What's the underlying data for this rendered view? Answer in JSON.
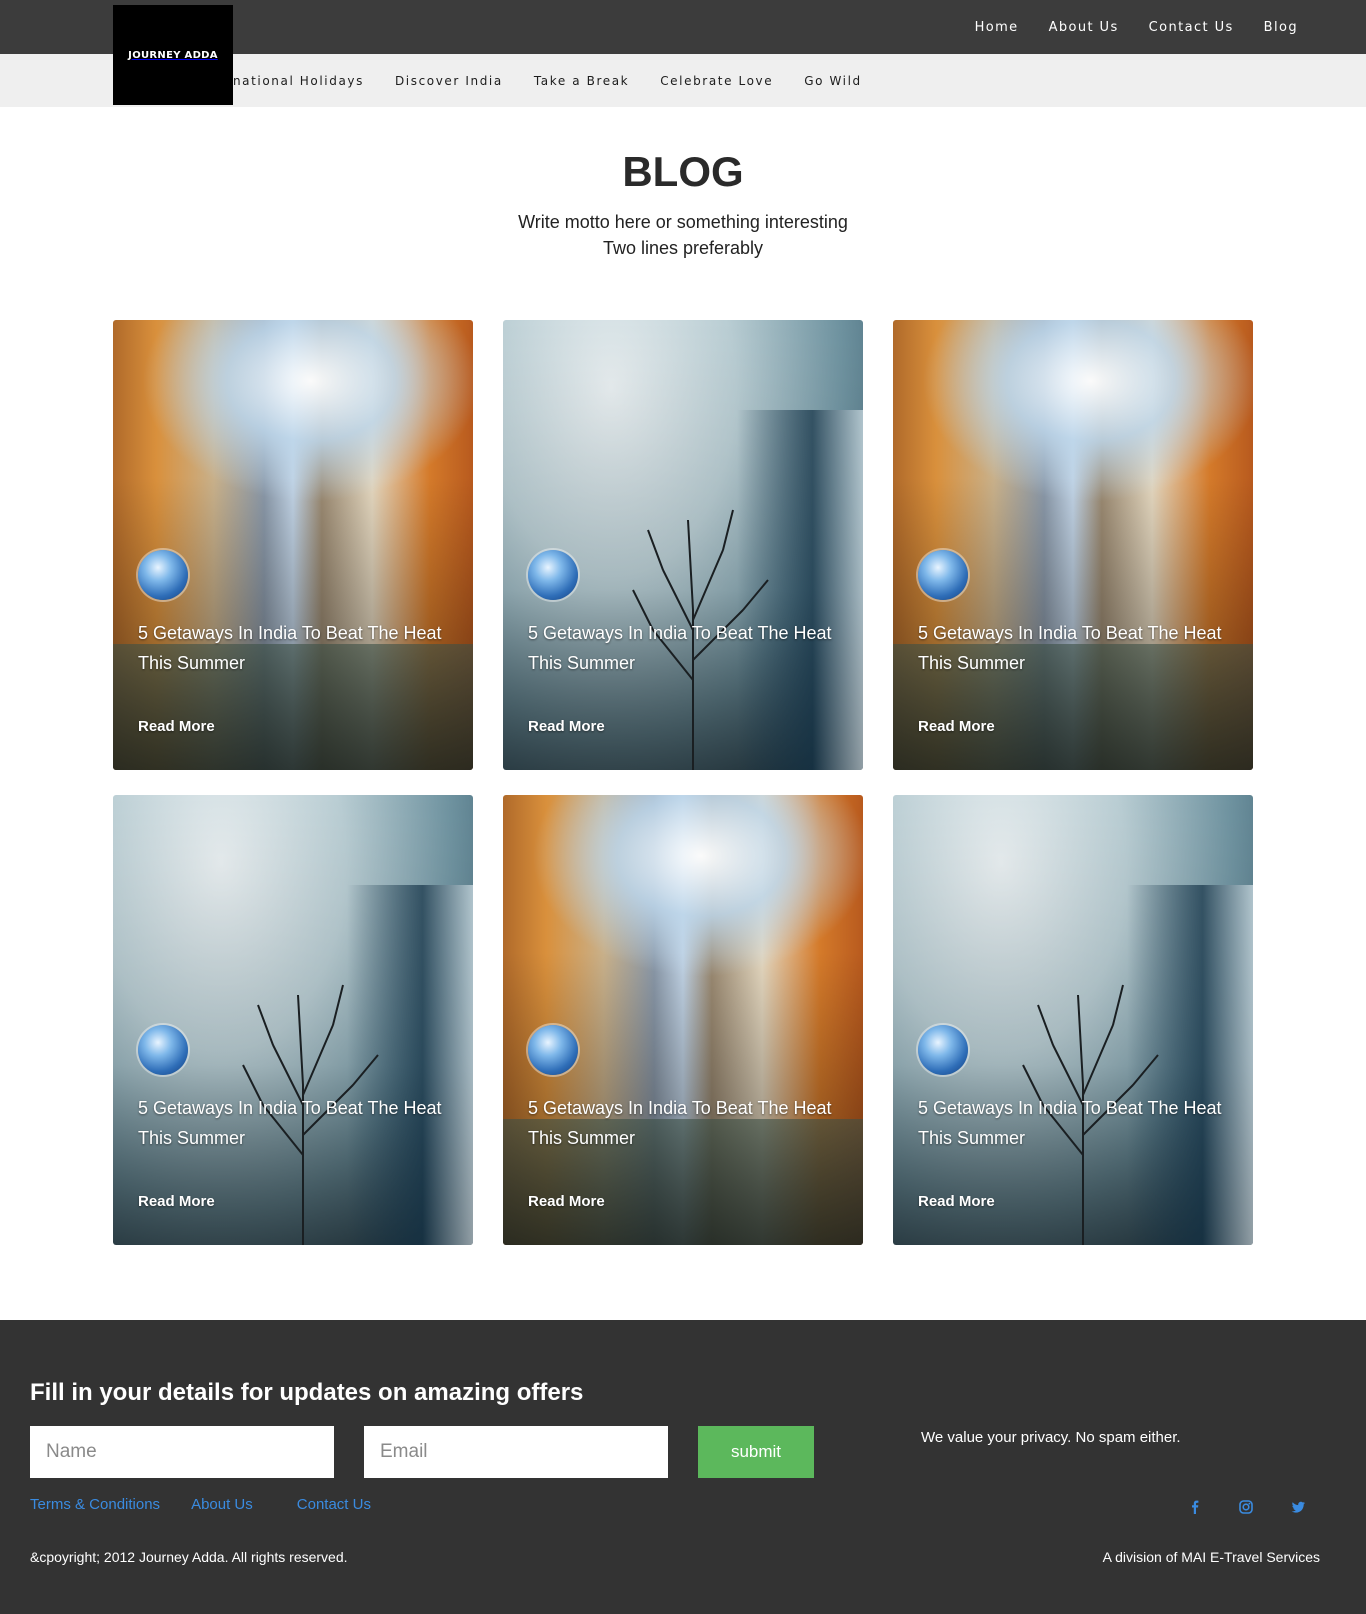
{
  "header": {
    "logo_text": "JOURNEY ADDA",
    "nav": [
      "Home",
      "About Us",
      "Contact Us",
      "Blog"
    ],
    "subnav": [
      "International Holidays",
      "Discover India",
      "Take a Break",
      "Celebrate Love",
      "Go Wild"
    ]
  },
  "hero": {
    "title": "BLOG",
    "motto_line1": "Write motto here or something interesting",
    "motto_line2": "Two lines preferably"
  },
  "posts": [
    {
      "image": "canal",
      "title": "5 Getaways In India To Beat The Heat This Summer",
      "cta": "Read More"
    },
    {
      "image": "fog",
      "title": "5 Getaways In India To Beat The Heat This Summer",
      "cta": "Read More"
    },
    {
      "image": "canal",
      "title": "5 Getaways In India To Beat The Heat This Summer",
      "cta": "Read More"
    },
    {
      "image": "fog",
      "title": "5 Getaways In India To Beat The Heat This Summer",
      "cta": "Read More"
    },
    {
      "image": "canal",
      "title": "5 Getaways In India To Beat The Heat This Summer",
      "cta": "Read More"
    },
    {
      "image": "fog",
      "title": "5 Getaways In India To Beat The Heat This Summer",
      "cta": "Read More"
    }
  ],
  "footer": {
    "heading": "Fill in your details for updates on amazing offers",
    "name_placeholder": "Name",
    "email_placeholder": "Email",
    "submit_label": "submit",
    "privacy_note": "We value your privacy. No spam either.",
    "links": [
      "Terms & Conditions",
      "About Us",
      "Contact Us"
    ],
    "social_icons": [
      "facebook-icon",
      "instagram-icon",
      "twitter-icon"
    ],
    "copyright": "&cpoyright; 2012 Journey Adda. All rights reserved.",
    "division": "A division of MAI E-Travel Services"
  },
  "colors": {
    "topbar": "#3c3c3c",
    "subbar": "#efefef",
    "footer": "#333333",
    "submit": "#5cb85c",
    "link": "#3a8be0"
  }
}
